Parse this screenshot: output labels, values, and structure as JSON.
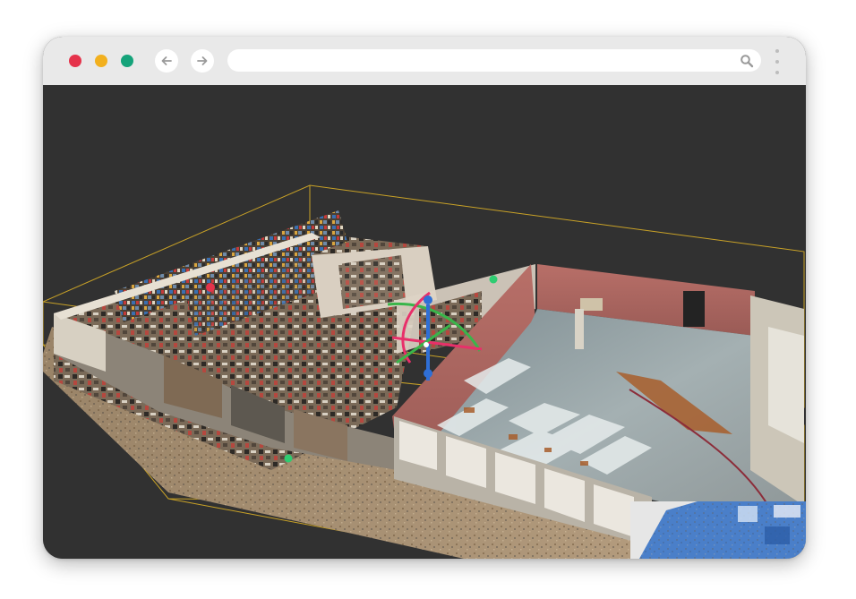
{
  "browser": {
    "url": "",
    "traffic_lights": {
      "close": "#e5334b",
      "minimize": "#f2b01e",
      "maximize": "#15a37a"
    },
    "icons": {
      "back": "arrow-left-icon",
      "forward": "arrow-right-icon",
      "search": "search-icon",
      "menu": "kebab-menu-icon"
    }
  },
  "viewer": {
    "background": "#313131",
    "bounding_box_color": "#c9a227",
    "gizmo": {
      "x_axis_color": "#e8306a",
      "y_axis_color": "#3ab54a",
      "z_axis_color": "#2f6fd6"
    },
    "markers_color": "#2ecc71",
    "pin_color": "#e5334b"
  }
}
